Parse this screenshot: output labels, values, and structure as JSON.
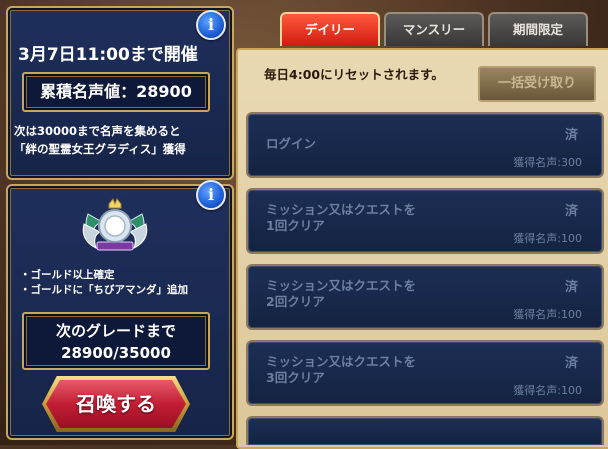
{
  "event_panel": {
    "period": "3月7日11:00まで開催",
    "fame_label": "累積名声値：28900",
    "desc_line1": "次は30000まで名声を集めると",
    "desc_line2": "「絆の聖霊女王グラディス」獲得"
  },
  "summon_panel": {
    "perk1": "・ゴールド以上確定",
    "perk2": "・ゴールドに「ちびアマンダ」追加",
    "grade_line1": "次のグレードまで",
    "grade_line2": "28900/35000",
    "summon_button": "召喚する"
  },
  "tabs": {
    "daily": "デイリー",
    "monthly": "マンスリー",
    "limited": "期間限定"
  },
  "mission_panel": {
    "reset_note": "毎日4:00にリセットされます。",
    "bulk_claim": "一括受け取り",
    "missions": [
      {
        "title1": "ログイン",
        "title2": "",
        "status": "済",
        "reward": "獲得名声:300"
      },
      {
        "title1": "ミッション又はクエストを",
        "title2": "1回クリア",
        "status": "済",
        "reward": "獲得名声:100"
      },
      {
        "title1": "ミッション又はクエストを",
        "title2": "2回クリア",
        "status": "済",
        "reward": "獲得名声:100"
      },
      {
        "title1": "ミッション又はクエストを",
        "title2": "3回クリア",
        "status": "済",
        "reward": "獲得名声:100"
      }
    ]
  },
  "icons": {
    "info": "i"
  }
}
